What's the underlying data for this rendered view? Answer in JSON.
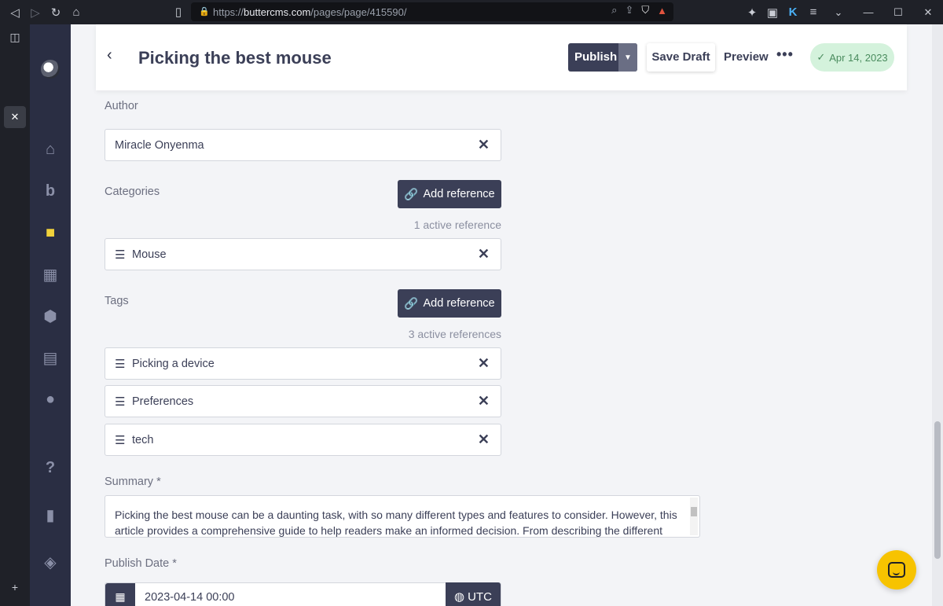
{
  "browser": {
    "url_prefix": "https://",
    "url_host": "buttercms.com",
    "url_path": "/pages/page/415590/"
  },
  "header": {
    "title": "Picking the best mouse",
    "publish_label": "Publish",
    "save_draft_label": "Save Draft",
    "preview_label": "Preview",
    "more_label": "•••",
    "status_date": "Apr 14, 2023"
  },
  "fields": {
    "author": {
      "label": "Author",
      "value": "Miracle Onyenma"
    },
    "categories": {
      "label": "Categories",
      "add_label": "Add reference",
      "count_text": "1 active reference",
      "items": [
        "Mouse"
      ]
    },
    "tags": {
      "label": "Tags",
      "add_label": "Add reference",
      "count_text": "3 active references",
      "items": [
        "Picking a device",
        "Preferences",
        "tech"
      ]
    },
    "summary": {
      "label": "Summary *",
      "value": "Picking the best mouse can be a daunting task, with so many different types and features to consider. However, this article provides a comprehensive guide to help readers make an informed decision. From describing the different"
    },
    "publish_date": {
      "label": "Publish Date *",
      "value": "2023-04-14 00:00",
      "timezone": "UTC"
    }
  },
  "colors": {
    "sidebar": "#2a2e43",
    "primary": "#3b3f57",
    "success_bg": "#d4f2dc",
    "chat": "#f7c300"
  }
}
